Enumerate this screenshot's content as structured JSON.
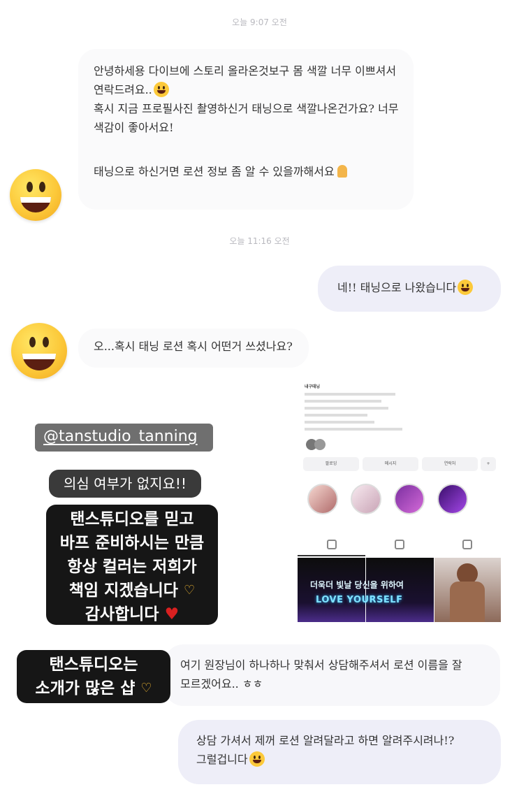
{
  "timestamps": {
    "first": "오늘 9:07 오전",
    "second": "오늘 11:16 오전"
  },
  "messages": {
    "in1": {
      "lines": [
        "안녕하세용 다이브에 스토리 올라온것보구 몸 색깔 너무 이쁘셔서",
        "연락드려요..",
        "혹시 지금 프로필사진 촬영하신거 태닝으로 색깔나온건가요? 너무",
        "색감이 좋아서요!"
      ]
    },
    "in2": {
      "text": "태닝으로 하신거면 로션 정보 좀 알 수 있을까해서요"
    },
    "out1": {
      "text": "네!!  태닝으로 나왔습니다"
    },
    "in3": {
      "text": "오...혹시 태닝 로션 혹시 어떤거 쓰셨나요?"
    },
    "in4": {
      "lines": [
        "여기 원장님이 하나하나 맞춰서 상담해주셔서 로션 이름을 잘",
        "모르겠어요.. ㅎㅎ"
      ]
    },
    "out2": {
      "lines": [
        "상담 가셔서 제꺼 로션 알려달라고 하면 알려주시려나!?",
        "그럴겁니다"
      ]
    }
  },
  "stickers": {
    "handle": "@tanstudio_tanning",
    "no_doubt": "의심 여부가 없지요!!",
    "trust_lines": [
      "탠스튜디오를 믿고",
      "바프 준비하시는 만큼",
      "항상 컬러는 저희가",
      "책임 지겠습니다",
      "감사합니다"
    ],
    "intro_lines": [
      "탠스튜디오는",
      "소개가 많은 샵"
    ]
  },
  "icons": {
    "avatar": "grinning-face-emoji",
    "smile": "grinning-face-emoji",
    "pray": "folded-hands-emoji",
    "heart_hands": "heart-hands-emoji",
    "heart": "red-heart-emoji"
  },
  "profile_shot": {
    "name_line": "내구태닝",
    "follow_label": "팔로잉",
    "message_label": "메시지",
    "contact_label": "연락처",
    "post_title": "더욱더 빛날 당신을 위하여",
    "post_subtitle": "LOVE YOURSELF"
  },
  "colors": {
    "bubble_in": "#fafafb",
    "bubble_out": "#eeeef8",
    "sticker_bg": "#161616",
    "handle_bg": "#6f6f6f",
    "accent_heart": "#d92020"
  }
}
